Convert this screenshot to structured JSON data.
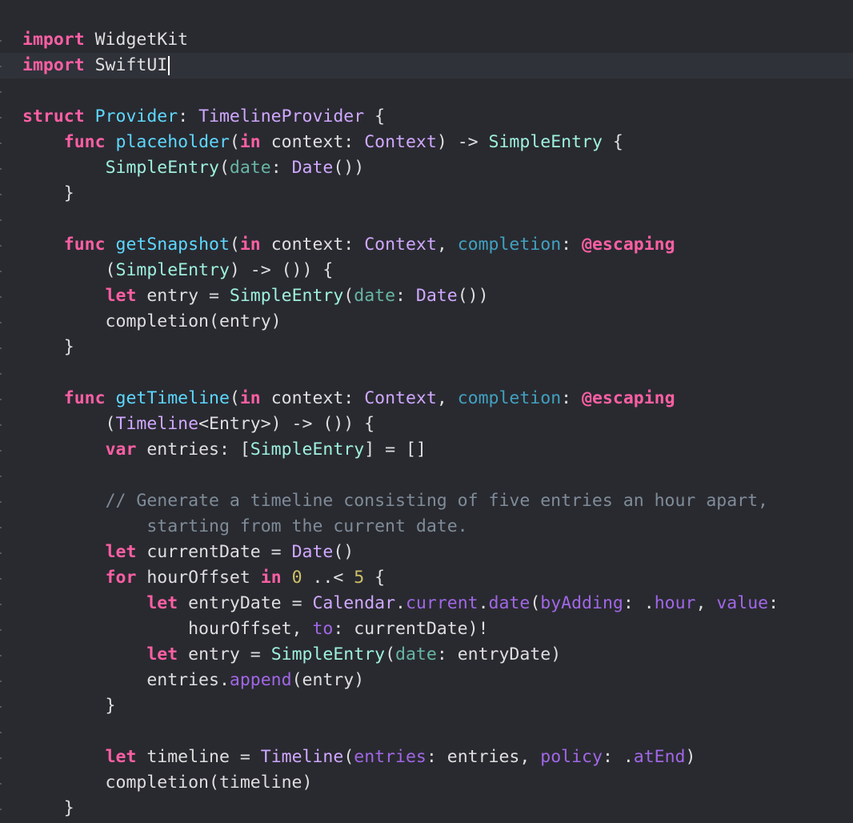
{
  "editor": {
    "language": "Swift",
    "current_line": 2,
    "colors": {
      "background": "#292a30",
      "current_line": "#2f3239",
      "keyword": "#fc5fa3",
      "declaration": "#5dd8ff",
      "project_type": "#9ef1dd",
      "system_type": "#d0a8ff",
      "project_function": "#67b7a4",
      "system_function": "#a167e6",
      "parameter": "#41a1c0",
      "comment": "#8fbf6a",
      "number": "#d0bf69",
      "plain": "#dfdfe0"
    },
    "lines": [
      [
        [
          "kw",
          "import"
        ],
        [
          "plain",
          " WidgetKit"
        ]
      ],
      [
        [
          "kw",
          "import"
        ],
        [
          "plain",
          " SwiftUI"
        ]
      ],
      [],
      [
        [
          "kw",
          "struct"
        ],
        [
          "plain",
          " "
        ],
        [
          "decl",
          "Provider"
        ],
        [
          "plain",
          ": "
        ],
        [
          "typesys",
          "TimelineProvider"
        ],
        [
          "plain",
          " {"
        ]
      ],
      [
        [
          "plain",
          "    "
        ],
        [
          "kw",
          "func"
        ],
        [
          "plain",
          " "
        ],
        [
          "decl",
          "placeholder"
        ],
        [
          "plain",
          "("
        ],
        [
          "kw",
          "in"
        ],
        [
          "plain",
          " context: "
        ],
        [
          "typesys",
          "Context"
        ],
        [
          "plain",
          ") -> "
        ],
        [
          "typeproj",
          "SimpleEntry"
        ],
        [
          "plain",
          " {"
        ]
      ],
      [
        [
          "plain",
          "        "
        ],
        [
          "typeproj",
          "SimpleEntry"
        ],
        [
          "plain",
          "("
        ],
        [
          "funcproj",
          "date"
        ],
        [
          "plain",
          ": "
        ],
        [
          "typesys",
          "Date"
        ],
        [
          "plain",
          "())"
        ]
      ],
      [
        [
          "plain",
          "    }"
        ]
      ],
      [],
      [
        [
          "plain",
          "    "
        ],
        [
          "kw",
          "func"
        ],
        [
          "plain",
          " "
        ],
        [
          "decl",
          "getSnapshot"
        ],
        [
          "plain",
          "("
        ],
        [
          "kw",
          "in"
        ],
        [
          "plain",
          " context: "
        ],
        [
          "typesys",
          "Context"
        ],
        [
          "plain",
          ", "
        ],
        [
          "param",
          "completion"
        ],
        [
          "plain",
          ": "
        ],
        [
          "kw",
          "@escaping"
        ]
      ],
      [
        [
          "plain",
          "        ("
        ],
        [
          "typeproj",
          "SimpleEntry"
        ],
        [
          "plain",
          ") -> ()) {"
        ]
      ],
      [
        [
          "plain",
          "        "
        ],
        [
          "kw",
          "let"
        ],
        [
          "plain",
          " entry = "
        ],
        [
          "typeproj",
          "SimpleEntry"
        ],
        [
          "plain",
          "("
        ],
        [
          "funcproj",
          "date"
        ],
        [
          "plain",
          ": "
        ],
        [
          "typesys",
          "Date"
        ],
        [
          "plain",
          "())"
        ]
      ],
      [
        [
          "plain",
          "        completion(entry)"
        ]
      ],
      [
        [
          "plain",
          "    }"
        ]
      ],
      [],
      [
        [
          "plain",
          "    "
        ],
        [
          "kw",
          "func"
        ],
        [
          "plain",
          " "
        ],
        [
          "decl",
          "getTimeline"
        ],
        [
          "plain",
          "("
        ],
        [
          "kw",
          "in"
        ],
        [
          "plain",
          " context: "
        ],
        [
          "typesys",
          "Context"
        ],
        [
          "plain",
          ", "
        ],
        [
          "param",
          "completion"
        ],
        [
          "plain",
          ": "
        ],
        [
          "kw",
          "@escaping"
        ]
      ],
      [
        [
          "plain",
          "        ("
        ],
        [
          "typesys",
          "Timeline"
        ],
        [
          "plain",
          "<Entry>) -> ()) {"
        ]
      ],
      [
        [
          "plain",
          "        "
        ],
        [
          "kw",
          "var"
        ],
        [
          "plain",
          " entries: ["
        ],
        [
          "typeproj",
          "SimpleEntry"
        ],
        [
          "plain",
          "] = []"
        ]
      ],
      [],
      [
        [
          "plain",
          "        "
        ],
        [
          "comment",
          "// Generate a timeline consisting of five entries an hour apart,"
        ]
      ],
      [
        [
          "plain",
          "            "
        ],
        [
          "comment",
          "starting from the current date."
        ]
      ],
      [
        [
          "plain",
          "        "
        ],
        [
          "kw",
          "let"
        ],
        [
          "plain",
          " currentDate = "
        ],
        [
          "typesys",
          "Date"
        ],
        [
          "plain",
          "()"
        ]
      ],
      [
        [
          "plain",
          "        "
        ],
        [
          "kw",
          "for"
        ],
        [
          "plain",
          " hourOffset "
        ],
        [
          "kw",
          "in"
        ],
        [
          "plain",
          " "
        ],
        [
          "num",
          "0"
        ],
        [
          "plain",
          " ..< "
        ],
        [
          "num",
          "5"
        ],
        [
          "plain",
          " {"
        ]
      ],
      [
        [
          "plain",
          "            "
        ],
        [
          "kw",
          "let"
        ],
        [
          "plain",
          " entryDate = "
        ],
        [
          "typesys",
          "Calendar"
        ],
        [
          "plain",
          "."
        ],
        [
          "funcsys",
          "current"
        ],
        [
          "plain",
          "."
        ],
        [
          "funcsys",
          "date"
        ],
        [
          "plain",
          "("
        ],
        [
          "funcsys",
          "byAdding"
        ],
        [
          "plain",
          ": ."
        ],
        [
          "funcsys",
          "hour"
        ],
        [
          "plain",
          ", "
        ],
        [
          "funcsys",
          "value"
        ],
        [
          "plain",
          ":"
        ]
      ],
      [
        [
          "plain",
          "                hourOffset, "
        ],
        [
          "funcsys",
          "to"
        ],
        [
          "plain",
          ": currentDate)!"
        ]
      ],
      [
        [
          "plain",
          "            "
        ],
        [
          "kw",
          "let"
        ],
        [
          "plain",
          " entry = "
        ],
        [
          "typeproj",
          "SimpleEntry"
        ],
        [
          "plain",
          "("
        ],
        [
          "funcproj",
          "date"
        ],
        [
          "plain",
          ": entryDate)"
        ]
      ],
      [
        [
          "plain",
          "            entries."
        ],
        [
          "funcsys",
          "append"
        ],
        [
          "plain",
          "(entry)"
        ]
      ],
      [
        [
          "plain",
          "        }"
        ]
      ],
      [],
      [
        [
          "plain",
          "        "
        ],
        [
          "kw",
          "let"
        ],
        [
          "plain",
          " timeline = "
        ],
        [
          "typesys",
          "Timeline"
        ],
        [
          "plain",
          "("
        ],
        [
          "funcsys",
          "entries"
        ],
        [
          "plain",
          ": entries, "
        ],
        [
          "funcsys",
          "policy"
        ],
        [
          "plain",
          ": ."
        ],
        [
          "funcsys",
          "atEnd"
        ],
        [
          "plain",
          ")"
        ]
      ],
      [
        [
          "plain",
          "        completion(timeline)"
        ]
      ],
      [
        [
          "plain",
          "    }"
        ]
      ]
    ]
  }
}
